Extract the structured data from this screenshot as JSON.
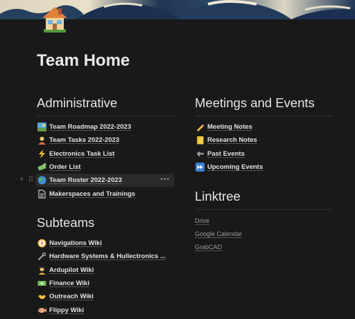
{
  "page": {
    "title": "Team Home"
  },
  "icons": {
    "page_icon": "house-icon",
    "block_plus": "plus-icon",
    "block_drag": "drag-handle-icon",
    "more": "more-options-icon"
  },
  "administrative": {
    "heading": "Administrative",
    "items": [
      {
        "label": "Team Roadmap 2022-2023",
        "icon": "map-icon"
      },
      {
        "label": "Team Tasks 2022-2023",
        "icon": "person-icon"
      },
      {
        "label": "Electronics Task List",
        "icon": "lightning-icon"
      },
      {
        "label": "Order List",
        "icon": "money-icon"
      },
      {
        "label": "Team Roster 2022-2023",
        "icon": "globe-icon"
      },
      {
        "label": "Makerspaces and Trainings",
        "icon": "document-icon"
      }
    ]
  },
  "subteams": {
    "heading": "Subteams",
    "items": [
      {
        "label": "Navigations Wiki",
        "icon": "compass-icon"
      },
      {
        "label": "Hardware Systems & Hullectronics ...",
        "icon": "wrench-icon"
      },
      {
        "label": "Ardupilot Wiki",
        "icon": "pilot-icon"
      },
      {
        "label": "Finance Wiki",
        "icon": "banknote-icon"
      },
      {
        "label": "Outreach Wiki",
        "icon": "handshake-icon"
      },
      {
        "label": "Flippy Wiki",
        "icon": "fish-icon"
      }
    ]
  },
  "meetings": {
    "heading": "Meetings and Events",
    "items": [
      {
        "label": "Meeting Notes",
        "icon": "pencil-icon"
      },
      {
        "label": "Research Notes",
        "icon": "notebook-icon"
      },
      {
        "label": "Past Events",
        "icon": "back-arrow-icon"
      },
      {
        "label": "Upcoming Events",
        "icon": "fast-forward-icon"
      }
    ]
  },
  "linktree": {
    "heading": "Linktree",
    "links": [
      "Drive",
      "Google Calendar",
      "GrabCAD"
    ]
  }
}
